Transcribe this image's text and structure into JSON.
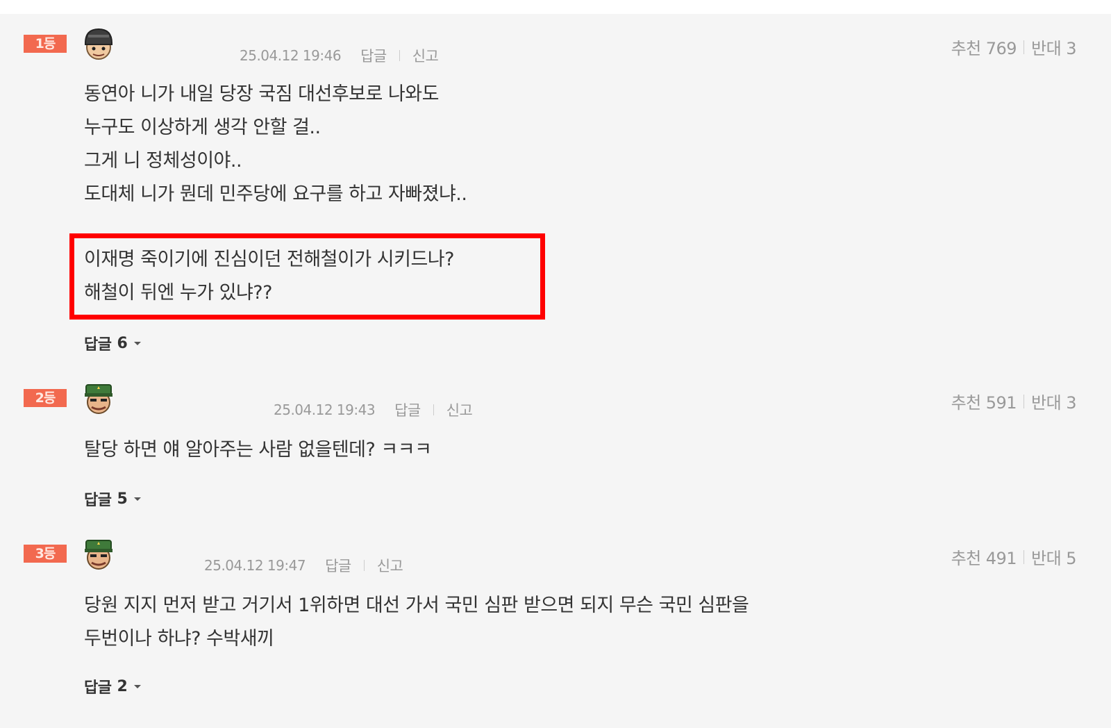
{
  "comments": [
    {
      "rank": "1등",
      "avatar": "soldier-helmet-avatar-icon",
      "date": "25.04.12 19:46",
      "reply_label": "답글",
      "report_label": "신고",
      "upvote_label": "추천",
      "upvotes": "769",
      "downvote_label": "반대",
      "downvotes": "3",
      "lines": [
        "동연아 니가 내일 당장 국짐 대선후보로 나와도",
        "누구도 이상하게 생각 안할 걸..",
        "그게 니 정체성이야..",
        "도대체 니가 뭔데 민주당에 요구를 하고 자빠졌냐..",
        "이재명 죽이기에 진심이던 전해철이가 시키드나?",
        "해철이 뒤엔 누가 있냐??"
      ],
      "replies_label": "답글",
      "replies_count": "6"
    },
    {
      "rank": "2등",
      "avatar": "soldier-green-cap-avatar-icon",
      "date": "25.04.12 19:43",
      "reply_label": "답글",
      "report_label": "신고",
      "upvote_label": "추천",
      "upvotes": "591",
      "downvote_label": "반대",
      "downvotes": "3",
      "lines": [
        "탈당 하면 얘 알아주는 사람 없을텐데? ㅋㅋㅋ"
      ],
      "replies_label": "답글",
      "replies_count": "5"
    },
    {
      "rank": "3등",
      "avatar": "soldier-green-cap-avatar-icon",
      "date": "25.04.12 19:47",
      "reply_label": "답글",
      "report_label": "신고",
      "upvote_label": "추천",
      "upvotes": "491",
      "downvote_label": "반대",
      "downvotes": "5",
      "lines": [
        "당원 지지 먼저 받고 거기서 1위하면 대선 가서 국민 심판 받으면 되지 무슨 국민 심판을",
        "두번이나 하냐? 수박새끼"
      ],
      "replies_label": "답글",
      "replies_count": "2"
    }
  ],
  "colors": {
    "rank_badge": "#f2694f",
    "highlight_box": "#ff0000",
    "panel_bg": "#f5f5f5"
  }
}
